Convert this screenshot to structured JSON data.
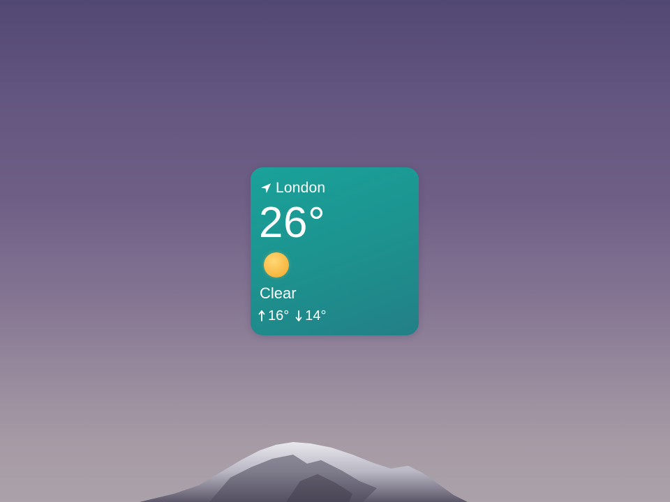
{
  "widget": {
    "location_icon": "location-arrow-icon",
    "city": "London",
    "temperature": "26°",
    "condition_icon": "sun-icon",
    "condition": "Clear",
    "high_icon": "arrow-up-icon",
    "high": "16°",
    "low_icon": "arrow-down-icon",
    "low": "14°"
  },
  "colors": {
    "widget_bg": "#1d918e",
    "sun": "#f7b63f",
    "text": "#ffffff"
  }
}
